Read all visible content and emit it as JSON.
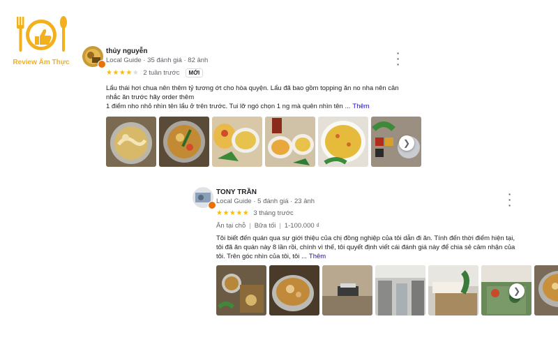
{
  "brand": {
    "logo_text": "Review Ẩm Thực",
    "color": "#f2b01e"
  },
  "reviews": [
    {
      "name": "thủy nguyễn",
      "guide": "Local Guide",
      "reviews_count": "35 đánh giá",
      "photos_count": "82 ảnh",
      "rating": 4,
      "time": "2 tuần trước",
      "new_badge": "MỚI",
      "text_line1": "Lẩu thái hơi chua nên thêm tỷ tương ớt cho hòa quyện.  Lẩu đã bao gồm topping ăn no nha nên cân",
      "text_line2": "nhắc ăn trước hãy order thêm",
      "text_line3": "1 điểm nho nhỏ nhìn tên lẩu ở trên trước. Tui lỡ ngó chọn 1 ng mà quên nhìn tên ...",
      "more_label": "Thêm"
    },
    {
      "name": "TONY TRẦN",
      "guide": "Local Guide",
      "reviews_count": "5 đánh giá",
      "photos_count": "23 ảnh",
      "rating": 5,
      "time": "3 tháng trước",
      "tag_1": "Ăn tại chỗ",
      "tag_2": "Bữa tối",
      "tag_3": "1-100.000 ₫",
      "text_line1": "Tôi biết đến quán qua sự giới thiệu của chị đồng nghiệp của tôi dẫn đi ăn. Tính đến thời điểm hiện tại,",
      "text_line2": "tôi đã ăn quán này 8 lần rồi, chính vì thế, tôi quyết định viết cái đánh giá này để chia sẻ cảm nhận của",
      "text_line3": "tôi. Trên góc nhìn của tôi, tôi ...",
      "more_label": "Thêm"
    }
  ],
  "icons": {
    "more": "more-vert-icon",
    "next": "chevron-right-icon",
    "star": "star-icon",
    "badge": "local-guide-badge-icon"
  },
  "colors": {
    "star": "#fbbc04",
    "link": "#1a0dab",
    "badge": "#e8710a"
  }
}
